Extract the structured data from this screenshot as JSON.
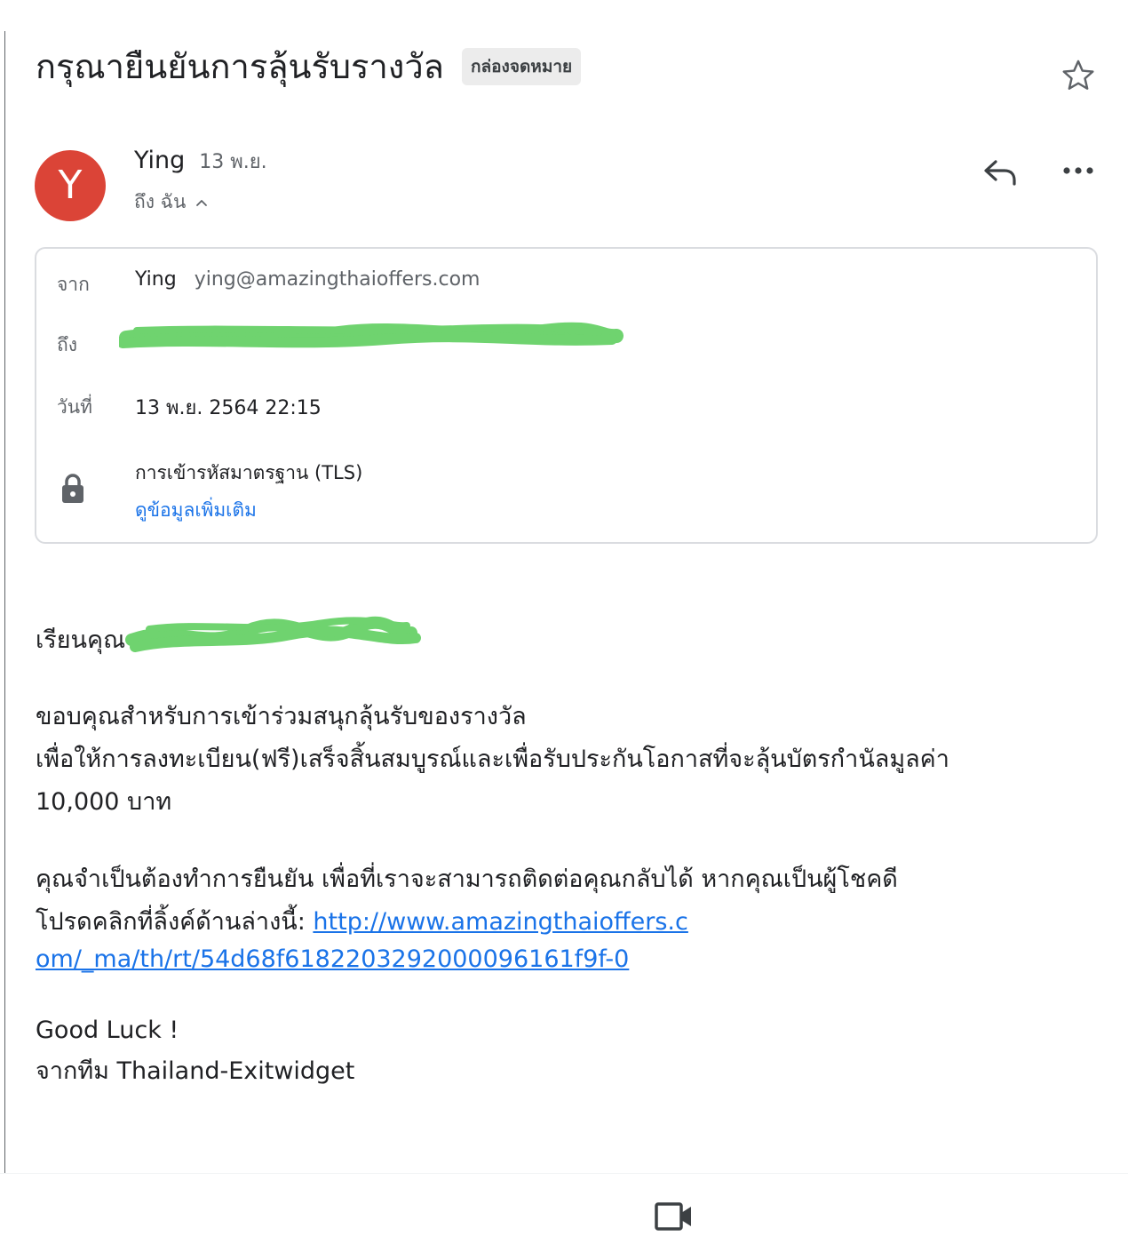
{
  "email": {
    "subject": "กรุณายืนยันการลุ้นรับรางวัล",
    "label": "กล่องจดหมาย"
  },
  "sender": {
    "avatar_letter": "Y",
    "avatar_color": "#db4437",
    "name": "Ying",
    "date_short": "13 พ.ย.",
    "to_summary": "ถึง ฉัน"
  },
  "details": {
    "from_label": "จาก",
    "from_name": "Ying",
    "from_email": "ying@amazingthaioffers.com",
    "to_label": "ถึง",
    "date_label": "วันที่",
    "date_value": "13 พ.ย. 2564 22:15",
    "encryption": "การเข้ารหัสมาตรฐาน (TLS)",
    "more_info_link": "ดูข้อมูลเพิ่มเติม"
  },
  "body": {
    "greeting": "เรียนคุณ",
    "para1_line1": "ขอบคุณสำหรับการเข้าร่วมสนุกลุ้นรับของรางวัล",
    "para1_line2": "เพื่อให้การลงทะเบียน(ฟรี)เสร็จสิ้นสมบูรณ์และเพื่อรับประกันโอกาสที่จะลุ้นบัตรกำนัลมูลค่า",
    "para1_line3": "10,000 บาท",
    "para2_line1": "คุณจำเป็นต้องทำการยืนยัน เพื่อที่เราจะสามารถติดต่อคุณกลับได้ หากคุณเป็นผู้โชคดี",
    "para2_line2_prefix": "โปรดคลิกที่ลิ้งค์ด้านล่างนี้: ",
    "link_part1": "http://www.amazingthaioffers.c",
    "link_part2": "om/_ma/th/rt/54d68f61822032920000961​61f9f-0",
    "sign_line1": "Good Luck !",
    "sign_line2": "จากทีม  Thailand-Exitwidget"
  },
  "colors": {
    "link": "#1a73e8",
    "redaction": "#6fd36f"
  },
  "icons": [
    "star-icon",
    "reply-icon",
    "more-icon",
    "lock-icon",
    "chevron-up-icon",
    "video-icon"
  ]
}
